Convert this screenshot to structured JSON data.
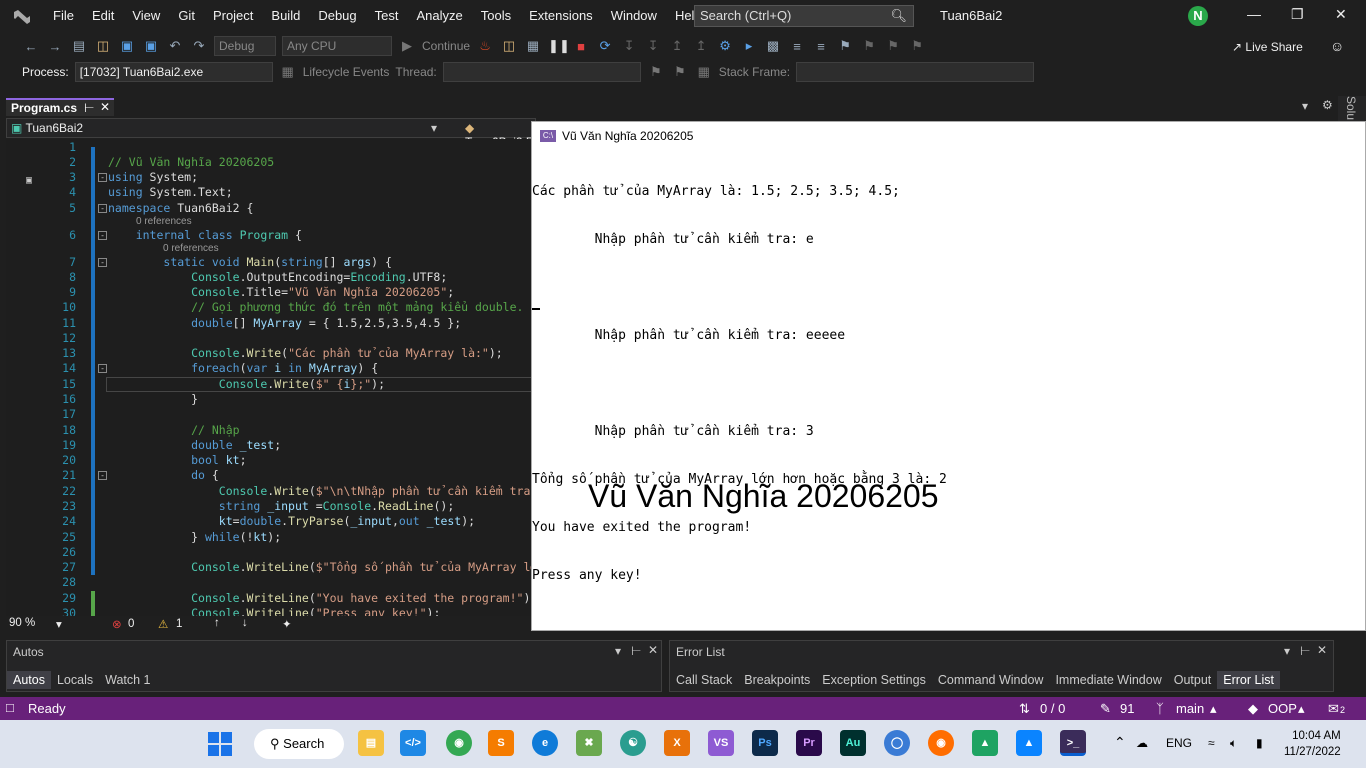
{
  "menu": {
    "items": [
      "File",
      "Edit",
      "View",
      "Git",
      "Project",
      "Build",
      "Debug",
      "Test",
      "Analyze",
      "Tools",
      "Extensions",
      "Window",
      "Help"
    ],
    "search_placeholder": "Search (Ctrl+Q)",
    "solution_name": "Tuan6Bai2",
    "avatar_letter": "N"
  },
  "toolbar": {
    "config": "Debug",
    "platform": "Any CPU",
    "continue": "Continue",
    "live_share": "Live Share"
  },
  "procbar": {
    "process_label": "Process:",
    "process_value": "[17032] Tuan6Bai2.exe",
    "lifecycle": "Lifecycle Events",
    "thread_label": "Thread:",
    "stack_label": "Stack Frame:"
  },
  "tab": {
    "name": "Program.cs",
    "side": "Solu"
  },
  "navbar": {
    "left": "Tuan6Bai2",
    "right": "Tuan6Bai2.P"
  },
  "code": {
    "refs": "0 references",
    "line_numbers": [
      "1",
      "2",
      "3",
      "4",
      "5",
      "6",
      "7",
      "8",
      "9",
      "10",
      "11",
      "12",
      "13",
      "14",
      "15",
      "16",
      "17",
      "18",
      "19",
      "20",
      "21",
      "22",
      "23",
      "24",
      "25",
      "26",
      "27",
      "28",
      "29",
      "30"
    ]
  },
  "editor_status": {
    "zoom": "90 %",
    "errors": "0",
    "warnings": "1"
  },
  "console": {
    "title": "Vũ Văn Nghĩa 20206205",
    "icon_label": "C:\\",
    "lines": [
      "Các phần tử của MyArray là: 1.5; 2.5; 3.5; 4.5;",
      "        Nhập phần tử cần kiểm tra: e",
      "",
      "        Nhập phần tử cần kiểm tra: eeeee",
      "",
      "        Nhập phần tử cần kiểm tra: 3",
      "Tổng số phần tử của MyArray lớn hơn hoặc bằng 3 là: 2",
      "You have exited the program!",
      "Press any key!"
    ],
    "watermark": "Vũ Văn Nghĩa 20206205"
  },
  "autos": {
    "title": "Autos",
    "tabs": [
      "Autos",
      "Locals",
      "Watch 1"
    ]
  },
  "errorlist": {
    "title": "Error List",
    "tabs": [
      "Call Stack",
      "Breakpoints",
      "Exception Settings",
      "Command Window",
      "Immediate Window",
      "Output",
      "Error List"
    ]
  },
  "status": {
    "ready": "Ready",
    "sync": "0 / 0",
    "edits": "91",
    "branch": "main",
    "repo": "OOP",
    "notif": "2"
  },
  "taskbar": {
    "search": "Search",
    "lang": "ENG",
    "time": "10:04 AM",
    "date": "11/27/2022"
  }
}
